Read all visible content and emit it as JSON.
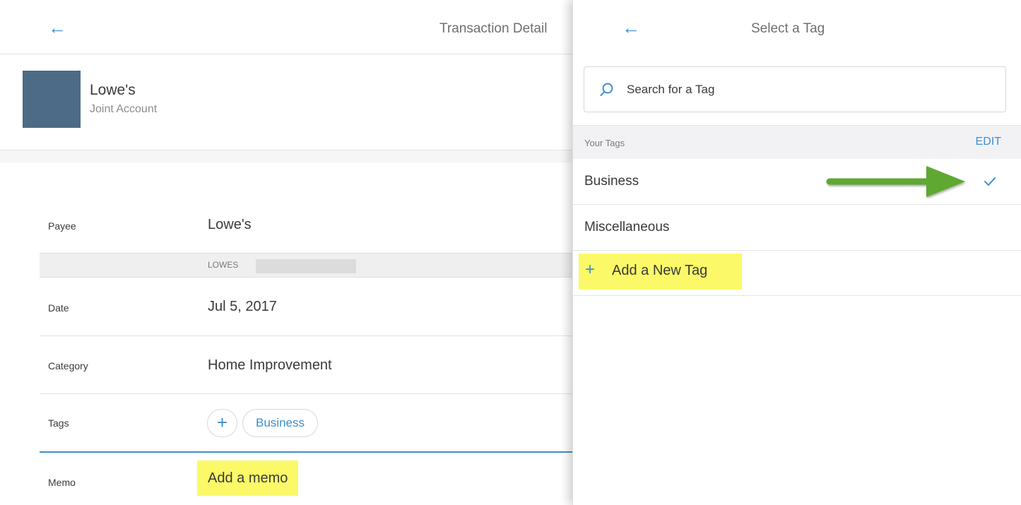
{
  "left_panel": {
    "title": "Transaction Detail",
    "back_icon": "back-arrow-icon",
    "merchant": {
      "name": "Lowe's",
      "account": "Joint Account",
      "logo_color": "#4d6a86"
    },
    "payee": {
      "label": "Payee",
      "value": "Lowe's",
      "original_description": "LOWES"
    },
    "date": {
      "label": "Date",
      "value": "Jul 5, 2017"
    },
    "category": {
      "label": "Category",
      "value": "Home Improvement"
    },
    "tags": {
      "label": "Tags",
      "add_icon": "+",
      "items": [
        "Business"
      ]
    },
    "memo": {
      "label": "Memo",
      "placeholder": "Add a memo"
    }
  },
  "right_panel": {
    "title": "Select a Tag",
    "back_icon": "back-arrow-icon",
    "search": {
      "placeholder": "Search for a Tag",
      "icon": "search-icon"
    },
    "section": {
      "label": "Your Tags",
      "edit_label": "EDIT"
    },
    "tags": [
      {
        "label": "Business",
        "selected": true
      },
      {
        "label": "Miscellaneous",
        "selected": false
      }
    ],
    "add_new": {
      "icon": "+",
      "label": "Add a New Tag"
    }
  },
  "colors": {
    "accent": "#3d8fd1",
    "highlight": "#fbf968",
    "annotation_arrow": "#5fa830"
  }
}
